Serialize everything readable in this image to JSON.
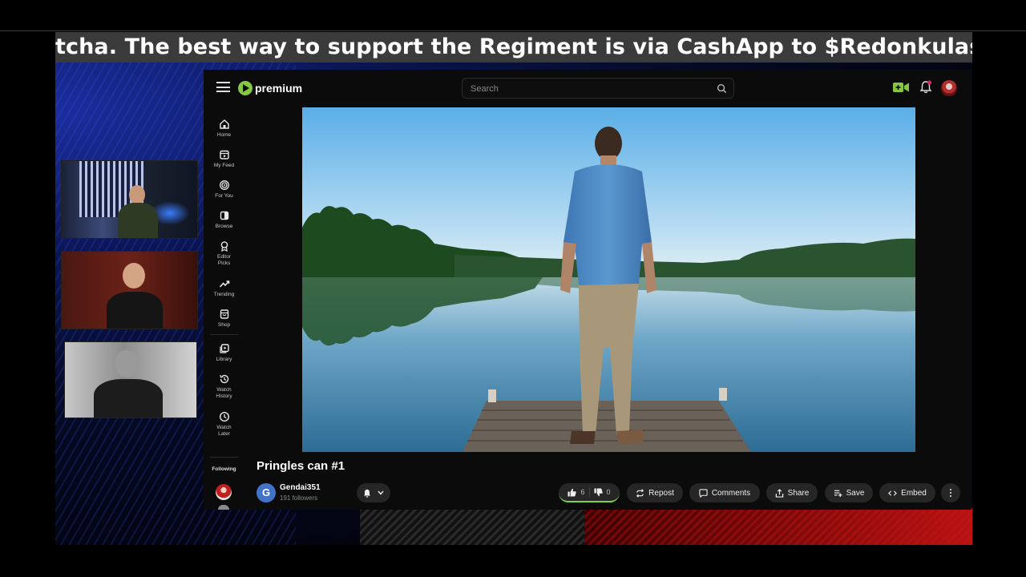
{
  "ticker": {
    "text": "tcha. The best way to support the Regiment is via CashApp to $Redonkulas"
  },
  "app": {
    "logo_text": "premium",
    "search": {
      "placeholder": "Search"
    },
    "sidebar": {
      "items": [
        {
          "label": "Home",
          "icon": "home-icon"
        },
        {
          "label": "My Feed",
          "icon": "feed-icon"
        },
        {
          "label": "For You",
          "icon": "target-icon"
        },
        {
          "label": "Browse",
          "icon": "browse-icon"
        },
        {
          "label": "Editor\nPicks",
          "icon": "award-icon"
        },
        {
          "label": "Trending",
          "icon": "trending-icon"
        },
        {
          "label": "Shop",
          "icon": "shop-icon"
        },
        {
          "label": "Library",
          "icon": "library-icon"
        },
        {
          "label": "Watch\nHistory",
          "icon": "history-icon"
        },
        {
          "label": "Watch\nLater",
          "icon": "clock-icon"
        }
      ],
      "following_label": "Following"
    },
    "video": {
      "title": "Pringles can #1",
      "channel": {
        "initial": "G",
        "name": "Gendai351",
        "followers": "191 followers"
      },
      "actions": {
        "likes": "6",
        "dislikes": "0",
        "repost": "Repost",
        "comments": "Comments",
        "share": "Share",
        "save": "Save",
        "embed": "Embed"
      }
    },
    "colors": {
      "brand": "#85c742",
      "background": "#0b0b0b",
      "pill": "#262626",
      "notification": "#e0245e",
      "vote_bar": "#7bd34a"
    }
  }
}
